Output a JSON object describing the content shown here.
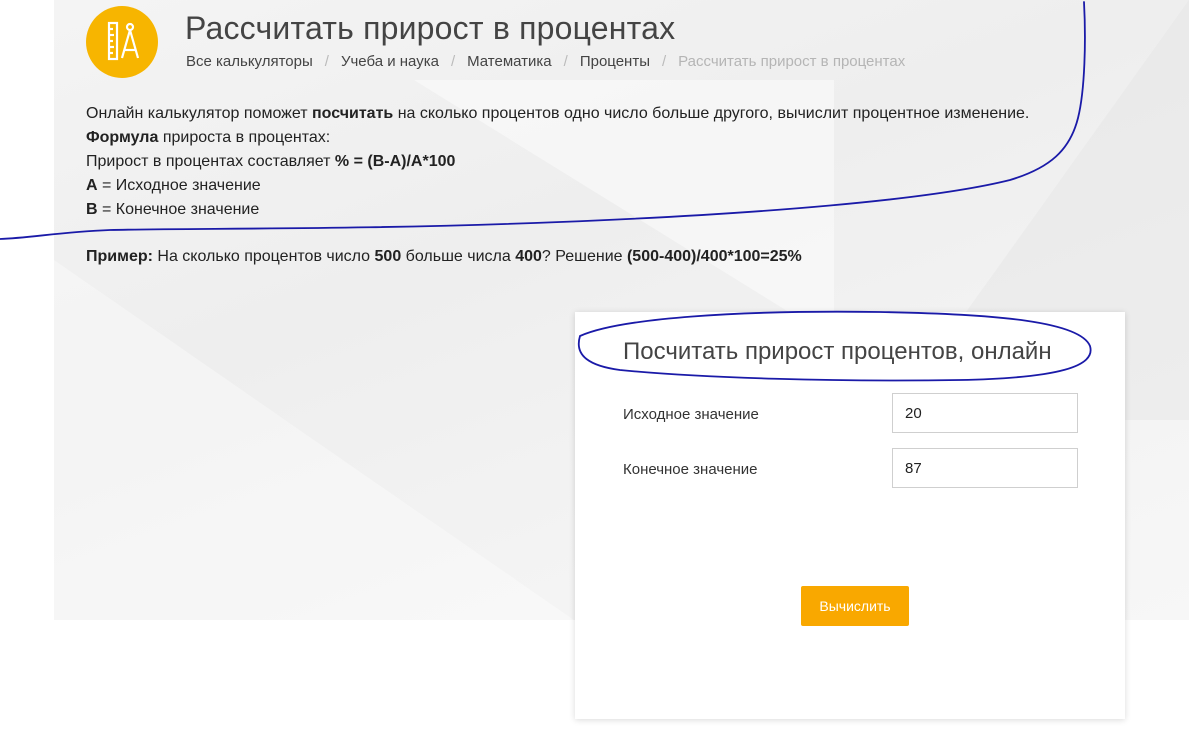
{
  "header": {
    "title": "Рассчитать прирост в процентах",
    "logo_icon": "ruler-compass-icon",
    "breadcrumb": [
      "Все калькуляторы",
      "Учеба и наука",
      "Математика",
      "Проценты",
      "Рассчитать прирост в процентах"
    ]
  },
  "intro": {
    "line1_a": "Онлайн калькулятор поможет ",
    "line1_b": "посчитать",
    "line1_c": " на сколько процентов одно число больше другого, вычислит процентное изменение.",
    "line2_a": "Формула",
    "line2_b": " прироста в процентах:",
    "line3_a": "Прирост в процентах составляет ",
    "line3_b": "% = (B-A)/A*100",
    "line4_a": "A",
    "line4_b": " = Исходное значение",
    "line5_a": "B",
    "line5_b": " = Конечное значение"
  },
  "example": {
    "label": "Пример:",
    "t1": " На сколько процентов число ",
    "n1": "500",
    "t2": " больше числа ",
    "n2": "400",
    "t3": "? Решение ",
    "solution": "(500-400)/400*100=25%"
  },
  "calculator": {
    "title": "Посчитать прирост процентов, онлайн",
    "initial_label": "Исходное значение",
    "initial_value": "20",
    "final_label": "Конечное значение",
    "final_value": "87",
    "button_label": "Вычислить"
  },
  "colors": {
    "accent": "#f9a800",
    "logo_bg": "#f7b500",
    "annotation": "#1a1aa8"
  }
}
